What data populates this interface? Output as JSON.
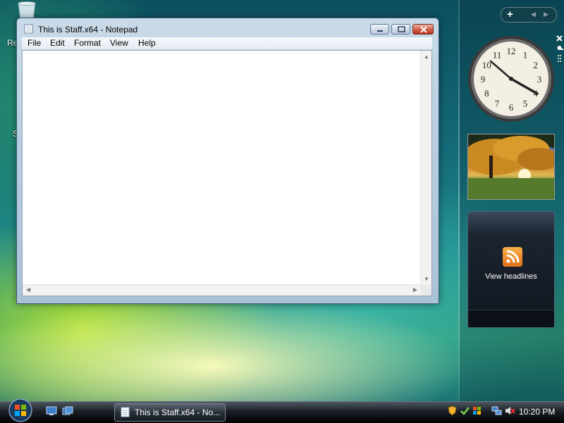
{
  "desktop": {
    "icon_text_1": "Re",
    "icon_text_2": "S"
  },
  "notepad": {
    "title": "This is Staff.x64 - Notepad",
    "menu": [
      "File",
      "Edit",
      "Format",
      "View",
      "Help"
    ],
    "content": ""
  },
  "sidebar": {
    "feed_label": "View headlines",
    "clock_numerals": [
      "12",
      "1",
      "2",
      "3",
      "4",
      "5",
      "6",
      "7",
      "8",
      "9",
      "10",
      "11"
    ]
  },
  "taskbar": {
    "task_label": "This is Staff.x64 - No...",
    "time": "10:20 PM"
  },
  "colors": {
    "accent": "#3b5c7a",
    "close_button": "#b8321c",
    "feed_icon": "#f29a35"
  }
}
